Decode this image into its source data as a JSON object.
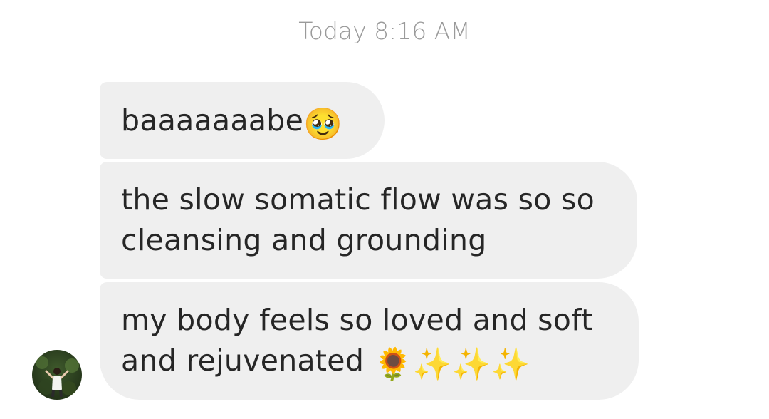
{
  "timestamp": "Today 8:16 AM",
  "messages": [
    {
      "text": "baaaaaaabe",
      "emoji": "🥹"
    },
    {
      "text": "the slow somatic flow was so so\ncleansing and grounding",
      "emoji": ""
    },
    {
      "text": "my body feels so loved and soft\nand rejuvenated ",
      "emoji": "🌻✨✨✨"
    }
  ],
  "avatar": {
    "icon": "avatar-photo"
  },
  "colors": {
    "bubble_bg": "#efefef",
    "text": "#262626",
    "timestamp": "#9a9a9a"
  }
}
